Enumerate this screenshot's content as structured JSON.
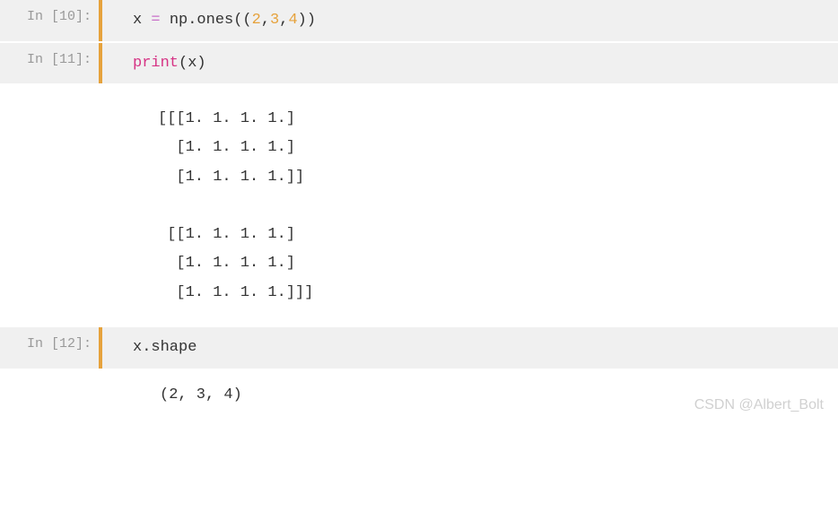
{
  "cells": {
    "c10": {
      "prompt": "In [10]:",
      "code": {
        "v_x": "x",
        "eq": " = ",
        "np": "np",
        "dot1": ".",
        "ones": "ones",
        "lp1": "((",
        "n2": "2",
        "cm1": ",",
        "n3": "3",
        "cm2": ",",
        "n4": "4",
        "rp1": "))"
      }
    },
    "c11": {
      "prompt": "In [11]:",
      "code": {
        "print": "print",
        "lp": "(",
        "x": "x",
        "rp": ")"
      },
      "output": "[[[1. 1. 1. 1.]\n  [1. 1. 1. 1.]\n  [1. 1. 1. 1.]]\n\n [[1. 1. 1. 1.]\n  [1. 1. 1. 1.]\n  [1. 1. 1. 1.]]]"
    },
    "c12": {
      "prompt": "In [12]:",
      "code": {
        "x": "x",
        "dot": ".",
        "shape": "shape"
      },
      "result": "(2, 3, 4)"
    }
  },
  "watermark": "CSDN @Albert_Bolt",
  "chart_data": {
    "type": "table",
    "description": "NumPy array of ones with shape (2,3,4)",
    "array_shape": [
      2,
      3,
      4
    ],
    "array_values_sample": 1.0,
    "shape_output": "(2, 3, 4)"
  }
}
